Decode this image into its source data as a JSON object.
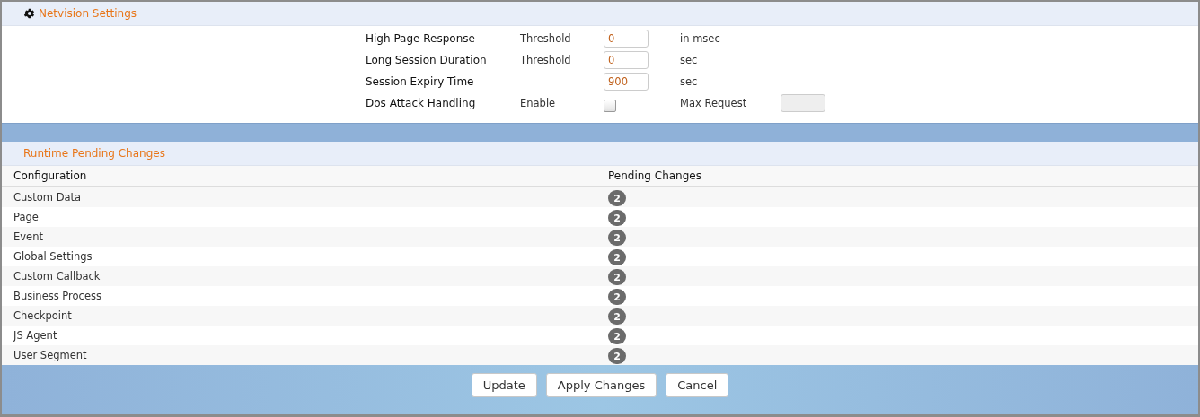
{
  "settings_panel": {
    "title": "Netvision Settings",
    "rows": [
      {
        "label": "High Page Response",
        "sublabel": "Threshold",
        "control": {
          "kind": "field",
          "value": "0"
        },
        "unit": "in msec"
      },
      {
        "label": "Long Session Duration",
        "sublabel": "Threshold",
        "control": {
          "kind": "field",
          "value": "0"
        },
        "unit": "sec"
      },
      {
        "label": "Session Expiry Time",
        "control": {
          "kind": "field",
          "value": "900"
        },
        "unit": "sec"
      },
      {
        "label": "Dos Attack Handling",
        "sublabel": "Enable",
        "control": {
          "kind": "checkbox",
          "checked": false
        },
        "unit": "Max Request",
        "extra_field": {
          "disabled": true
        }
      }
    ]
  },
  "pending_panel": {
    "title": "Runtime Pending Changes",
    "table": {
      "columns": [
        "Configuration",
        "Pending Changes"
      ],
      "rows": [
        {
          "configuration": "Custom Data",
          "pending": "2"
        },
        {
          "configuration": "Page",
          "pending": "2"
        },
        {
          "configuration": "Event",
          "pending": "2"
        },
        {
          "configuration": "Global Settings",
          "pending": "2"
        },
        {
          "configuration": "Custom Callback",
          "pending": "2"
        },
        {
          "configuration": "Business Process",
          "pending": "2"
        },
        {
          "configuration": "Checkpoint",
          "pending": "2"
        },
        {
          "configuration": "JS Agent",
          "pending": "2"
        },
        {
          "configuration": "User Segment",
          "pending": "2"
        }
      ]
    }
  },
  "buttons": [
    "Update",
    "Apply Changes",
    "Cancel"
  ]
}
